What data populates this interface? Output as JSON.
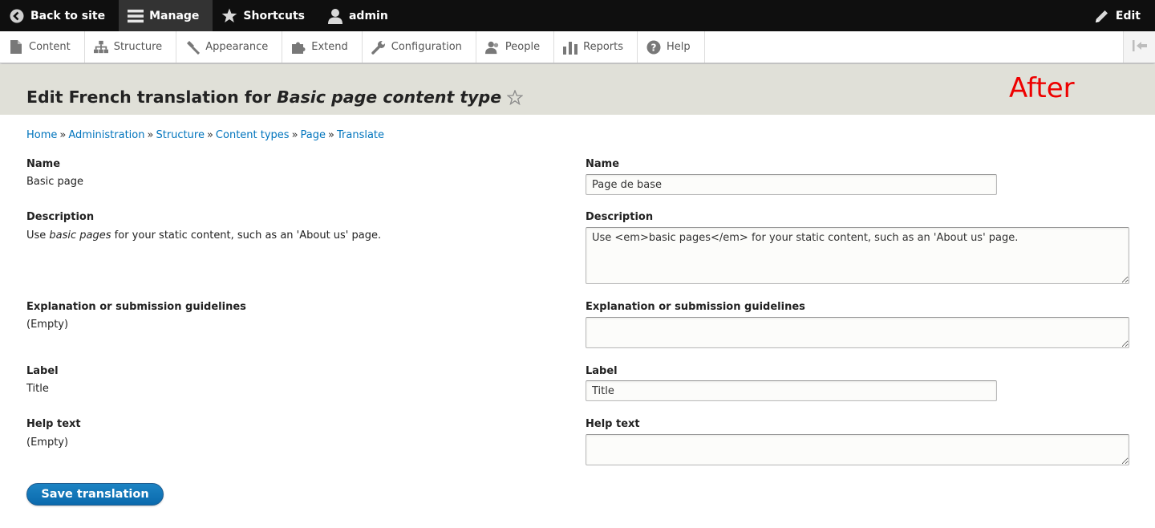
{
  "toolbar": {
    "back_label": "Back to site",
    "manage_label": "Manage",
    "shortcuts_label": "Shortcuts",
    "user_label": "admin",
    "edit_label": "Edit"
  },
  "tray": {
    "items": [
      {
        "label": "Content",
        "icon": "file-icon"
      },
      {
        "label": "Structure",
        "icon": "structure-icon"
      },
      {
        "label": "Appearance",
        "icon": "paintbrush-icon"
      },
      {
        "label": "Extend",
        "icon": "puzzle-icon"
      },
      {
        "label": "Configuration",
        "icon": "wrench-icon"
      },
      {
        "label": "People",
        "icon": "people-icon"
      },
      {
        "label": "Reports",
        "icon": "bar-chart-icon"
      },
      {
        "label": "Help",
        "icon": "help-icon"
      }
    ]
  },
  "page": {
    "title_prefix": "Edit French translation for ",
    "title_em": "Basic page content type",
    "overlay_label": "After"
  },
  "breadcrumb": {
    "items": [
      "Home",
      "Administration",
      "Structure",
      "Content types",
      "Page",
      "Translate"
    ],
    "separator": "»"
  },
  "source": {
    "name_label": "Name",
    "name_value": "Basic page",
    "description_label": "Description",
    "description_pre": "Use ",
    "description_em": "basic pages",
    "description_post": " for your static content, such as an 'About us' page.",
    "explanation_label": "Explanation or submission guidelines",
    "explanation_value": "(Empty)",
    "label_label": "Label",
    "label_value": "Title",
    "help_label": "Help text",
    "help_value": "(Empty)"
  },
  "translation": {
    "name_label": "Name",
    "name_value": "Page de base",
    "description_label": "Description",
    "description_value": "Use <em>basic pages</em> for your static content, such as an 'About us' page.",
    "explanation_label": "Explanation or submission guidelines",
    "explanation_value": "",
    "label_label": "Label",
    "label_value": "Title",
    "help_label": "Help text",
    "help_value": ""
  },
  "actions": {
    "save_label": "Save translation"
  },
  "colors": {
    "toolbar_bg": "#0f0f0f",
    "header_bg": "#e0e0d8",
    "link": "#0074bd",
    "button": "#0a6aad",
    "overlay_red": "#ee0000"
  }
}
